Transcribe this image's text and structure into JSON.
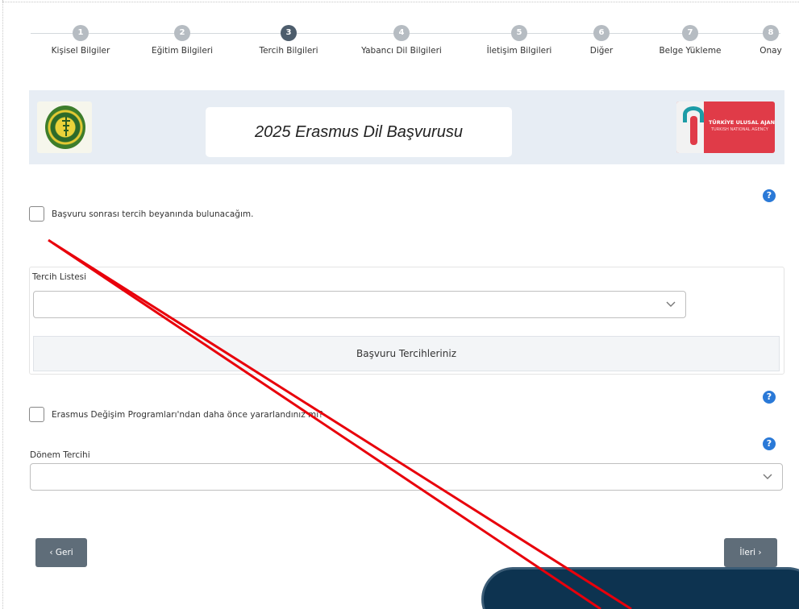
{
  "stepper": {
    "steps": [
      {
        "num": "1",
        "label": "Kişisel Bilgiler"
      },
      {
        "num": "2",
        "label": "Eğitim Bilgileri"
      },
      {
        "num": "3",
        "label": "Tercih Bilgileri"
      },
      {
        "num": "4",
        "label": "Yabancı Dil Bilgileri"
      },
      {
        "num": "5",
        "label": "İletişim Bilgileri"
      },
      {
        "num": "6",
        "label": "Diğer"
      },
      {
        "num": "7",
        "label": "Belge Yükleme"
      },
      {
        "num": "8",
        "label": "Onay"
      }
    ],
    "active_step": 3
  },
  "banner": {
    "title": "2025 Erasmus Dil Başvurusu",
    "partner_logo_text": "TÜRKİYE ULUSAL AJANSI",
    "partner_logo_subtext": "TURKISH NATIONAL AGENCY"
  },
  "form": {
    "tercih_checkbox_label": "Başvuru sonrası tercih beyanında bulunacağım.",
    "tercih_list_label": "Tercih Listesi",
    "tercih_list_value": "",
    "preferences_header": "Başvuru Tercihleriniz",
    "erasmus_checkbox_label": "Erasmus Değişim Programları'ndan daha önce yararlandınız mı?",
    "donem_label": "Dönem Tercihi",
    "donem_value": ""
  },
  "nav": {
    "back_label": "‹ Geri",
    "next_label": "İleri ›"
  },
  "icons": {
    "help": "?",
    "chevron": "chevron-down-icon"
  },
  "colors": {
    "active_step": "#4d5d6c",
    "inactive_step": "#b6bcc2",
    "help_icon": "#2a79d7",
    "button": "#5f6d79",
    "banner_bg": "#e7edf4",
    "annotation": "#e8000b",
    "partner_logo": "#e03b48"
  }
}
